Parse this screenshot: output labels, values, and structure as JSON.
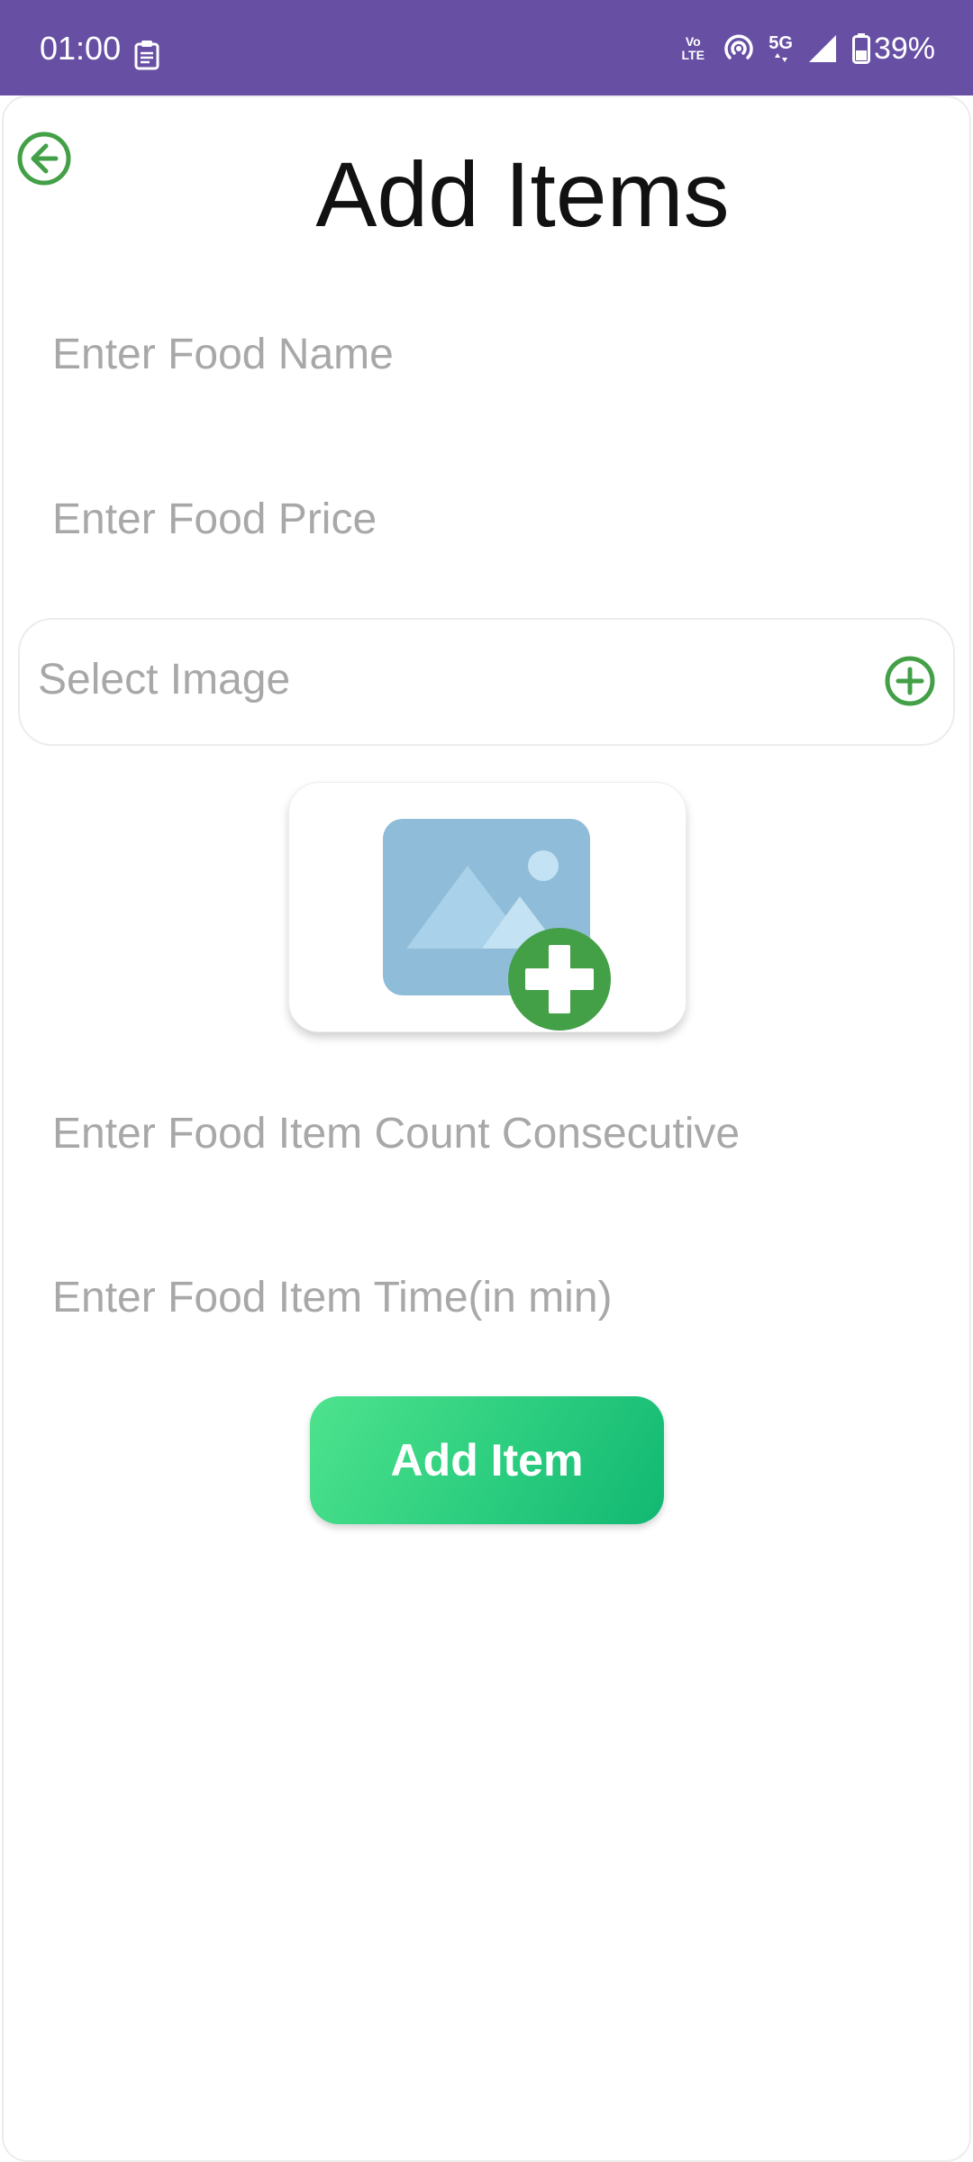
{
  "status_bar": {
    "time": "01:00",
    "network_volte": "Vo LTE",
    "network_type": "5G",
    "battery_percent": "39%",
    "background_color": "#6750a4",
    "icons": [
      "clipboard-icon",
      "volte-icon",
      "hotspot-icon",
      "signal-5g-icon",
      "signal-strength-icon",
      "battery-icon"
    ]
  },
  "header": {
    "title": "Add Items",
    "back_icon": "arrow-left-circle-icon"
  },
  "form": {
    "food_name": {
      "placeholder": "Enter Food Name",
      "value": ""
    },
    "food_price": {
      "placeholder": "Enter Food Price",
      "value": ""
    },
    "select_image": {
      "label": "Select Image",
      "icon": "plus-circle-icon"
    },
    "image_preview": {
      "icon": "add-image-icon"
    },
    "item_count": {
      "placeholder": "Enter Food Item Count Consecutive",
      "value": ""
    },
    "item_time": {
      "placeholder": "Enter Food Item Time(in min)",
      "value": ""
    },
    "submit_label": "Add Item"
  },
  "colors": {
    "accent_green": "#43a047",
    "button_gradient_start": "#4ee38d",
    "button_gradient_end": "#12b872",
    "placeholder_gray": "#a8a8a8"
  }
}
